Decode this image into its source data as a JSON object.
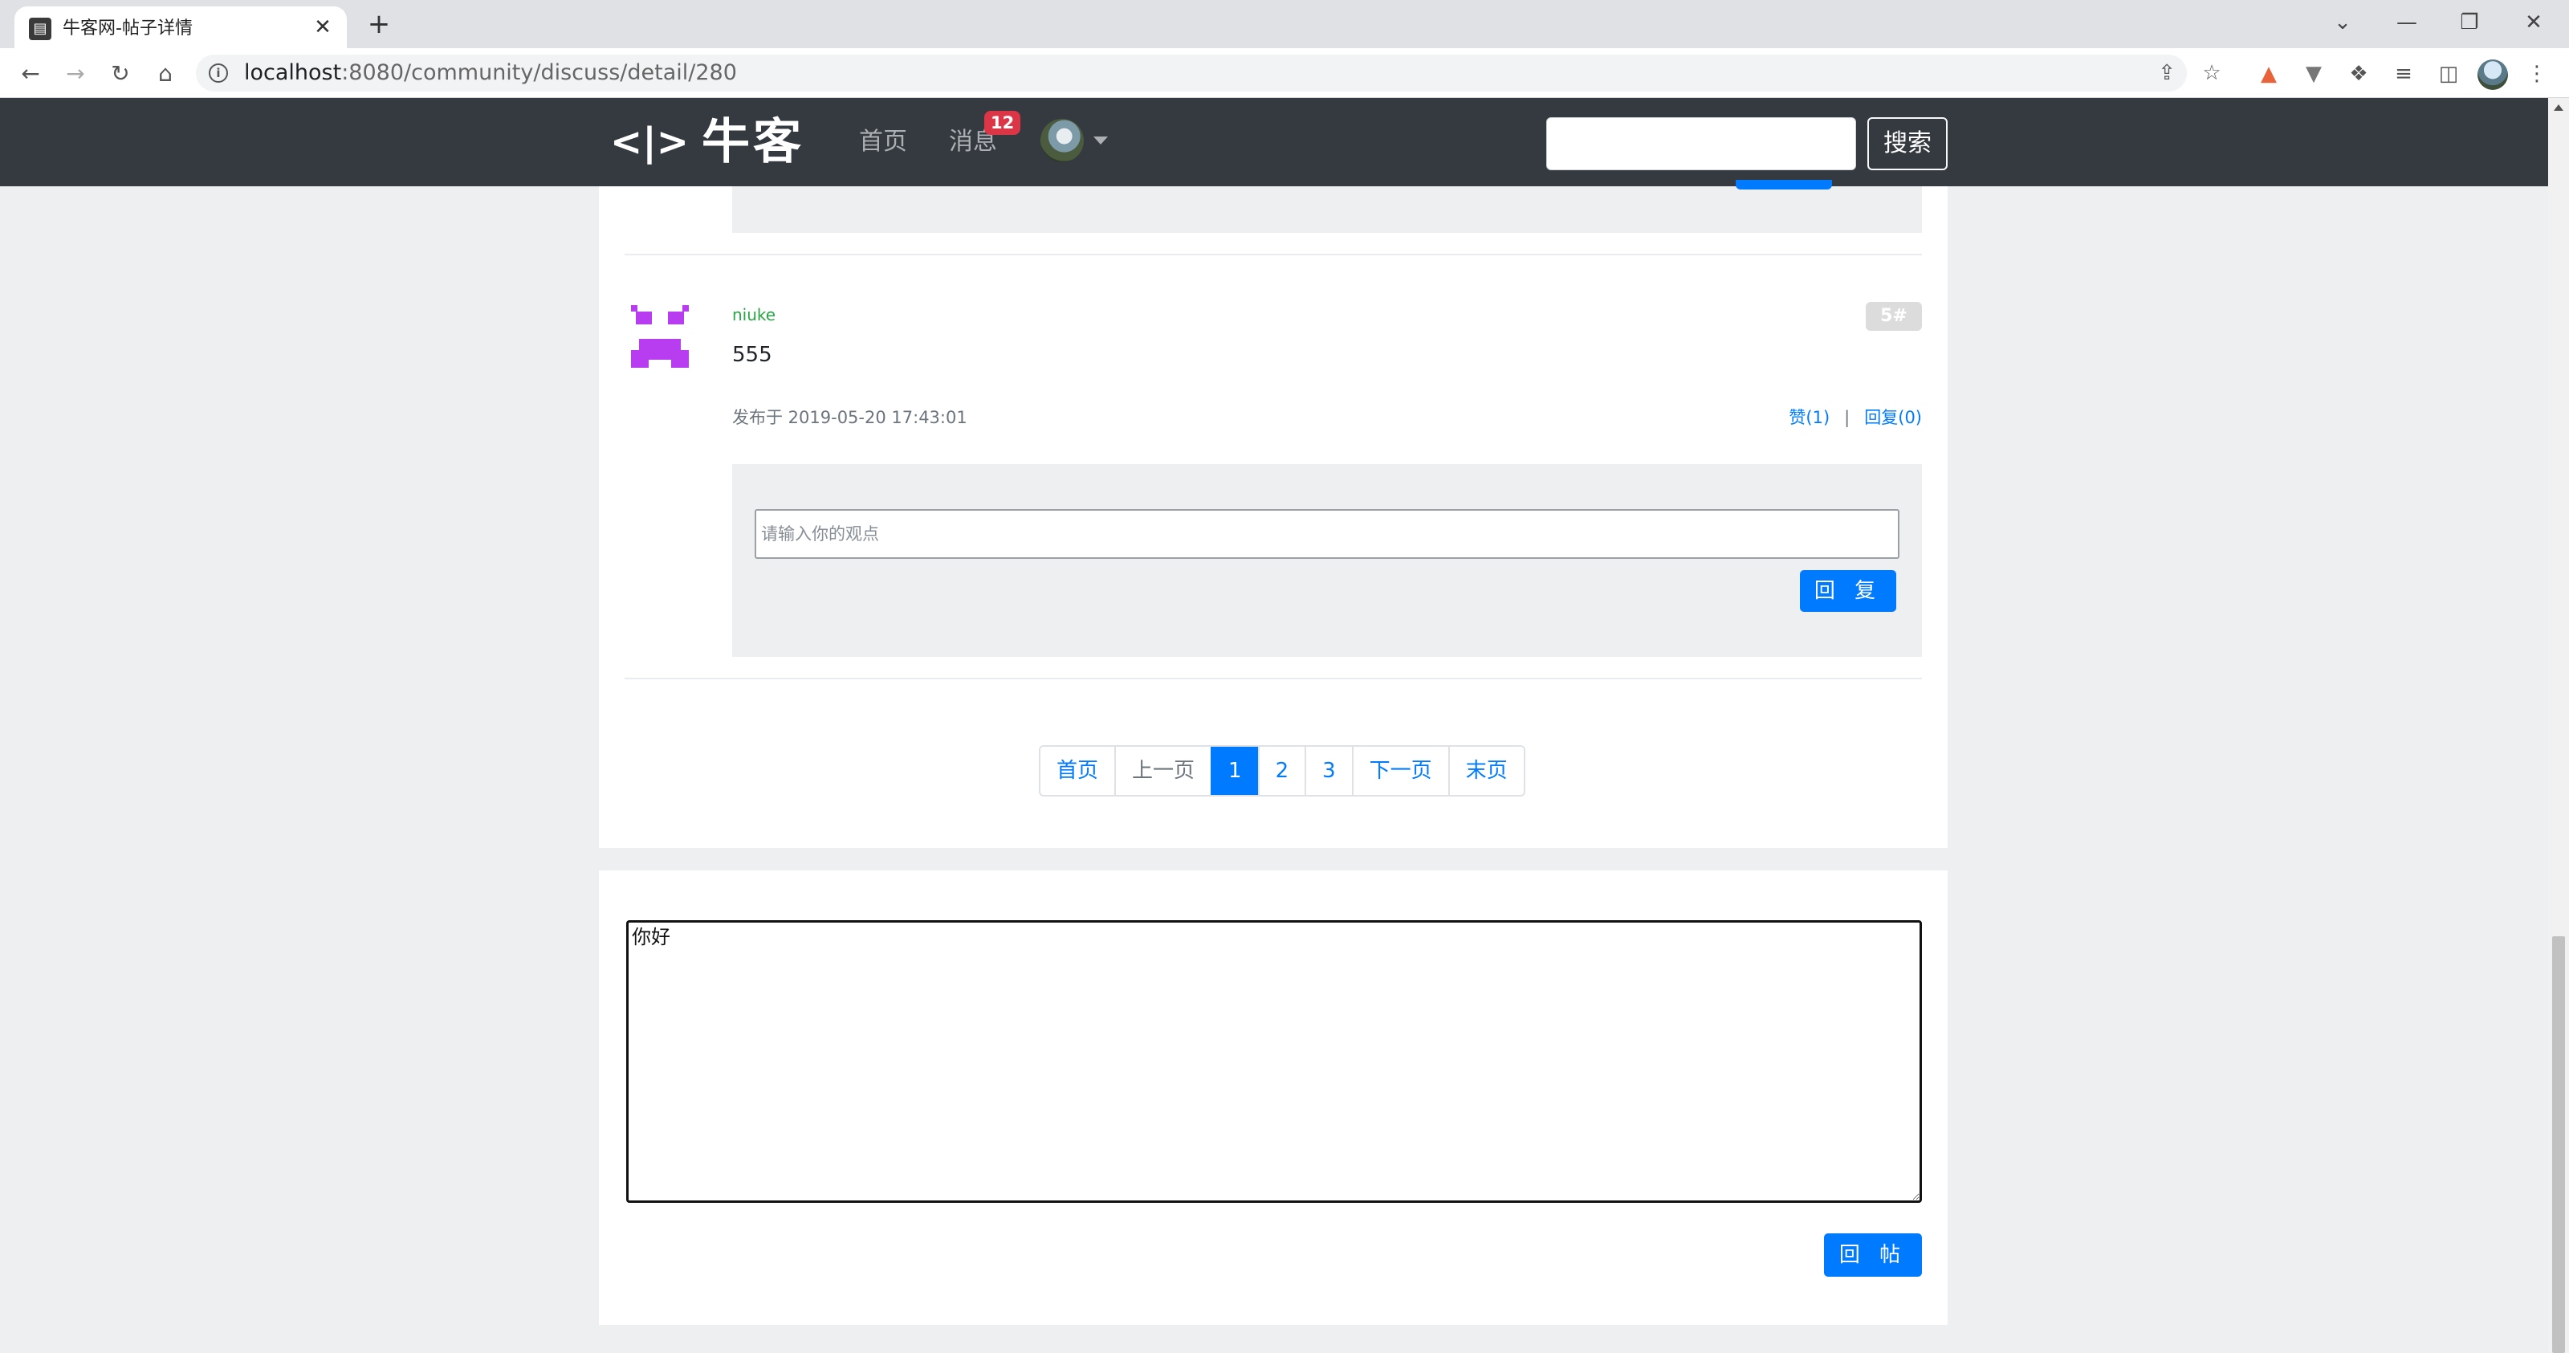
{
  "browser": {
    "tab_title": "牛客网-帖子详情",
    "tab_icon": "page-icon",
    "url_host": "localhost",
    "url_path": ":8080/community/discuss/detail/280"
  },
  "navbar": {
    "logo_text": "牛客",
    "logo_mark": "<|>",
    "links": [
      "首页",
      "消息"
    ],
    "message_count": "12",
    "search_placeholder": "",
    "search_button": "搜索"
  },
  "comment": {
    "username": "niuke",
    "floor": "5#",
    "content": "555",
    "posted_label": "发布于 2019-05-20 17:43:01",
    "like_label": "赞(1)",
    "separator": "|",
    "reply_count_label": "回复(0)",
    "reply_placeholder": "请输入你的观点",
    "reply_button": "回 复"
  },
  "pagination": {
    "first": "首页",
    "prev": "上一页",
    "pages": [
      "1",
      "2",
      "3"
    ],
    "current_page": "1",
    "next": "下一页",
    "last": "末页"
  },
  "post_reply": {
    "textarea_value": "你好",
    "submit_button": "回 帖"
  },
  "colors": {
    "primary": "#007bff",
    "navbar": "#343a40",
    "badge": "#dc3545",
    "username": "#28a745",
    "avatar_identicon": "#b83cf0"
  }
}
